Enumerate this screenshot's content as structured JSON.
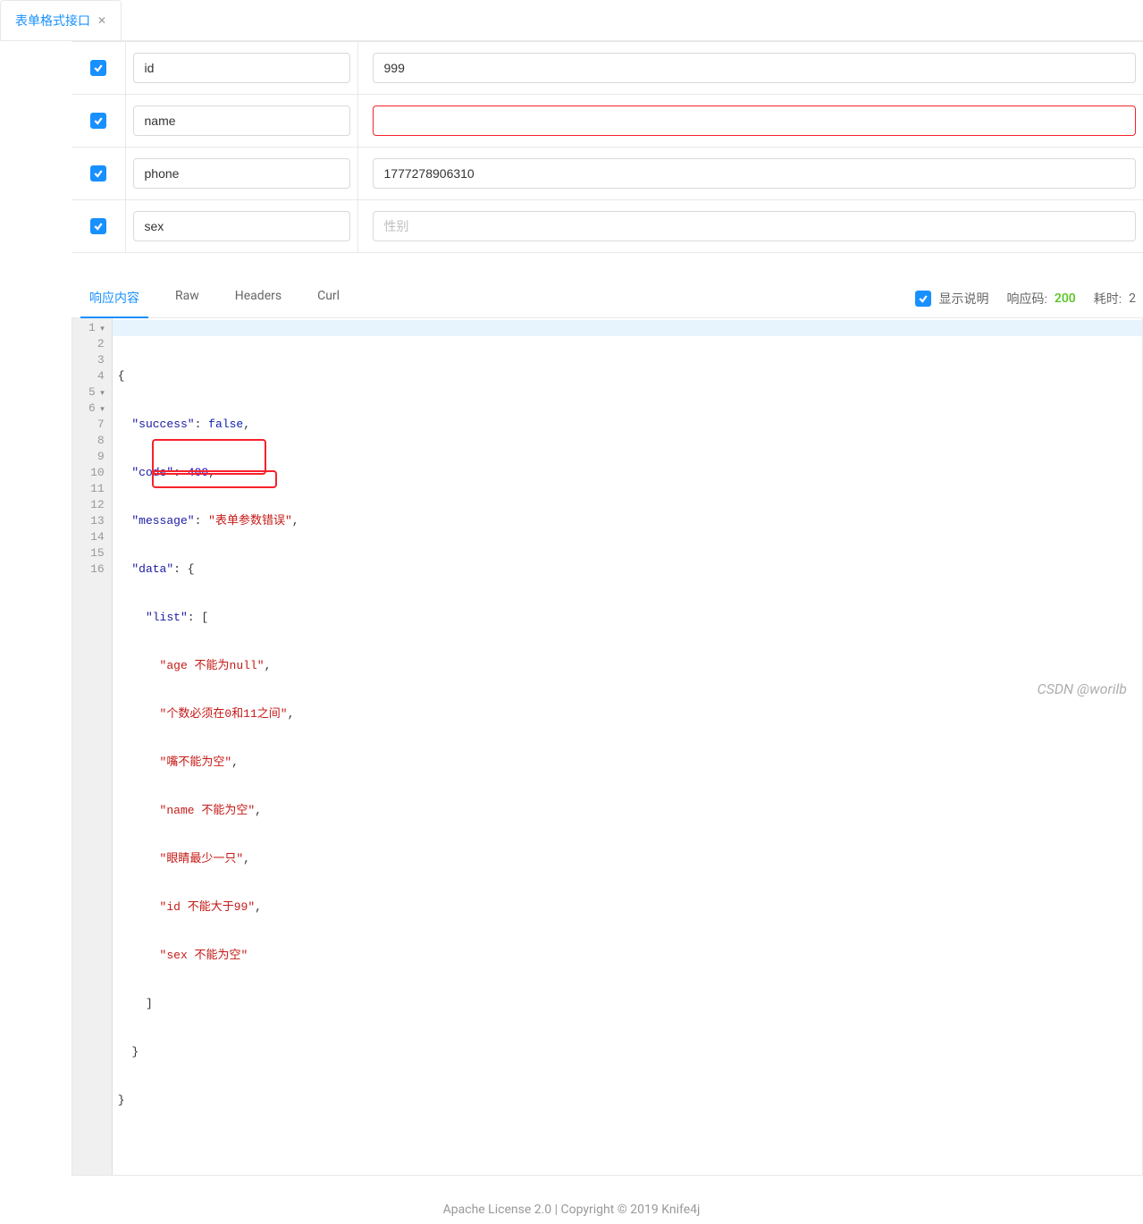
{
  "tab": {
    "label": "表单格式接口"
  },
  "form": {
    "rows": [
      {
        "key": "id",
        "value": "999",
        "placeholder": "",
        "error": false
      },
      {
        "key": "name",
        "value": "",
        "placeholder": "",
        "error": true
      },
      {
        "key": "phone",
        "value": "1777278906310",
        "placeholder": "",
        "error": false
      },
      {
        "key": "sex",
        "value": "",
        "placeholder": "性别",
        "error": false
      }
    ]
  },
  "response": {
    "tabs": {
      "content": "响应内容",
      "raw": "Raw",
      "headers": "Headers",
      "curl": "Curl"
    },
    "show_desc_label": "显示说明",
    "code_label": "响应码:",
    "code_value": "200",
    "time_label": "耗时:",
    "time_value": "2"
  },
  "json_lines": {
    "l1": "{",
    "l2_k": "\"success\"",
    "l2_v": "false",
    "l3_k": "\"code\"",
    "l3_v": "400",
    "l4_k": "\"message\"",
    "l4_v": "\"表单参数错误\"",
    "l5_k": "\"data\"",
    "l6_k": "\"list\"",
    "l7": "\"age 不能为null\"",
    "l8": "\"个数必须在0和11之间\"",
    "l9": "\"嘴不能为空\"",
    "l10": "\"name 不能为空\"",
    "l11": "\"眼睛最少一只\"",
    "l12": "\"id 不能大于99\"",
    "l13": "\"sex 不能为空\""
  },
  "watermark": "CSDN @worilb",
  "footer": "Apache License 2.0 | Copyright © 2019 Knife4j"
}
